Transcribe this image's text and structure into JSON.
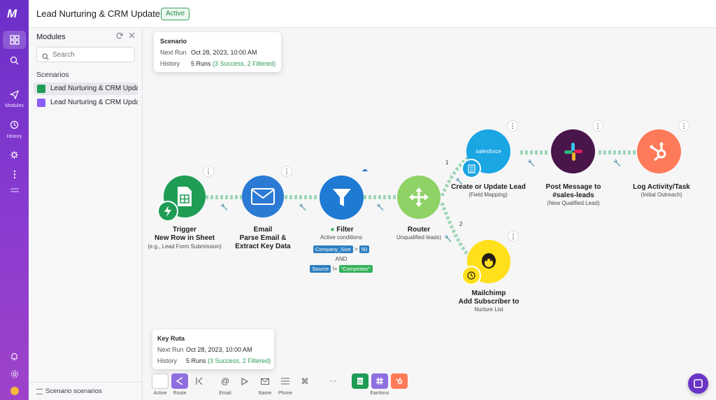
{
  "app": {
    "title": "Lead Nurturing & CRM Update",
    "status_badge": "Active",
    "logo_text": "M"
  },
  "rail": {
    "modules_label": "Modules",
    "history_label": "History"
  },
  "panel": {
    "title": "Modules",
    "search_placeholder": "Search",
    "section_label": "Scenarios",
    "scenarios": [
      {
        "label": "Lead Nurturing & CRM Update",
        "color": "#1f9d55"
      },
      {
        "label": "Lead Nurturing & CRM Update",
        "color": "#8b5cf6"
      }
    ],
    "footer_label": "Scenario scenarios"
  },
  "tooltip_top": {
    "heading": "Scenario",
    "next_run_key": "Next Run",
    "next_run_value": "Oct 28, 2023, 10:00 AM",
    "history_key": "History",
    "history_runs": "5 Runs",
    "history_detail": "(3 Success, 2 Filtered)"
  },
  "tooltip_bottom": {
    "heading": "Key Ruta",
    "next_run_key": "Next Run",
    "next_run_value": "Oct 28, 2023, 10:00 AM",
    "history_key": "History",
    "history_runs": "5 Runs",
    "history_detail": "(3 Success, 2 Filtered)"
  },
  "nodes": {
    "trigger": {
      "label1": "Trigger",
      "label2": "New Row in Sheet",
      "sub": "(e.g., Lead Form Submission)"
    },
    "email": {
      "label1": "Email",
      "label2": "Parse Email &",
      "label3": "Extract Key Data"
    },
    "filter": {
      "label": "Filter",
      "sub": "Active conditions",
      "cond1_field": "Company_Size",
      "cond1_op": ">",
      "cond1_val": "50",
      "and": "AND",
      "cond2_field": "Source",
      "cond2_op": "!=",
      "cond2_val": "\"Competitor\""
    },
    "router": {
      "label": "Router",
      "sub": "Unqualified leads)",
      "route1": "1",
      "route2": "2"
    },
    "salesforce": {
      "label": "Create or Update Lead",
      "sub": "(Field Mapping)",
      "logo_text": "salesforce"
    },
    "slack": {
      "label1": "Post Message to",
      "label2": "#sales-leads",
      "sub": "(New Qualified Lead)"
    },
    "hubspot": {
      "label": "Log Activity/Task",
      "sub": "(Initial Outreach)"
    },
    "mailchimp": {
      "label1": "Mailchimp",
      "label2": "Add Subscriber to",
      "sub": "Nurture List"
    }
  },
  "toolbar": {
    "active_label": "Active",
    "route_label": "Route",
    "email_label": "Email",
    "name_label": "Name",
    "phone_label": "Phone",
    "more_label": "···",
    "apps_label": "Eamlons"
  }
}
